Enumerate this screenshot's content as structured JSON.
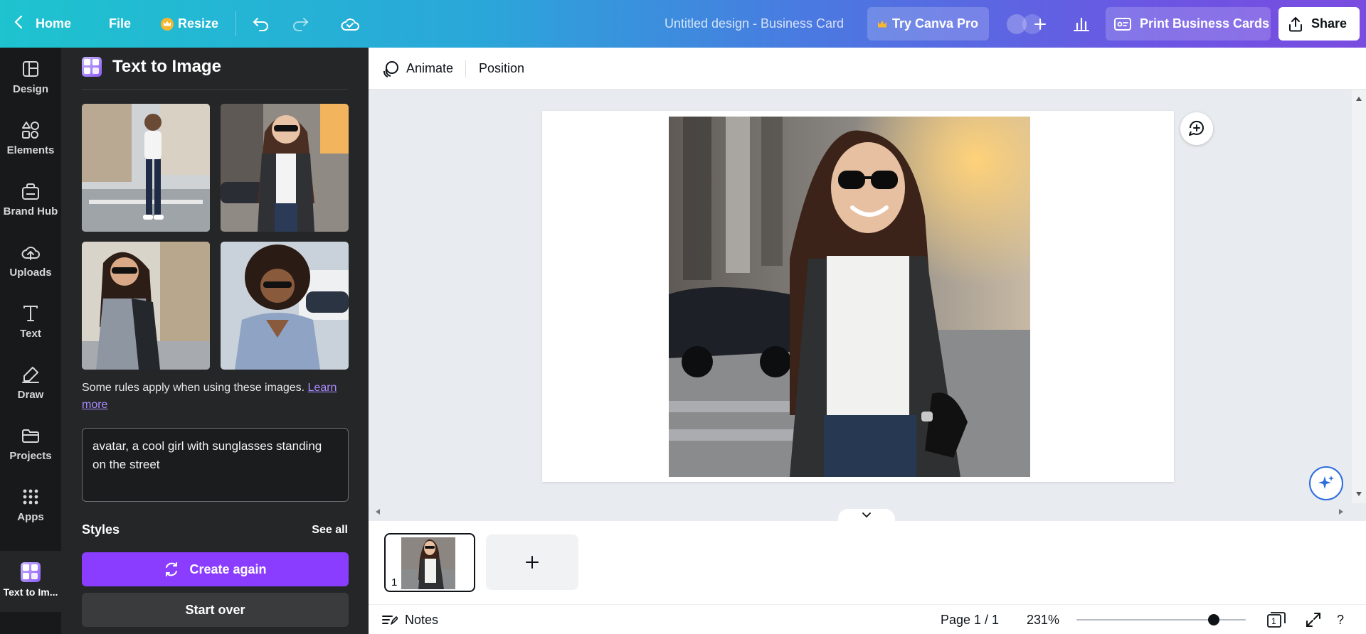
{
  "topbar": {
    "home": "Home",
    "file": "File",
    "resize": "Resize",
    "design_title": "Untitled design - Business Card",
    "try_pro": "Try Canva Pro",
    "print": "Print Business Cards",
    "share": "Share"
  },
  "rail": {
    "items": [
      {
        "label": "Design",
        "icon": "layout-icon"
      },
      {
        "label": "Elements",
        "icon": "shapes-icon"
      },
      {
        "label": "Brand Hub",
        "icon": "brand-icon"
      },
      {
        "label": "Uploads",
        "icon": "cloud-upload-icon"
      },
      {
        "label": "Text",
        "icon": "text-icon"
      },
      {
        "label": "Draw",
        "icon": "pen-icon"
      },
      {
        "label": "Projects",
        "icon": "folder-icon"
      },
      {
        "label": "Apps",
        "icon": "grid-icon"
      },
      {
        "label": "Text to Im...",
        "icon": "text-to-image-icon"
      }
    ]
  },
  "panel": {
    "title": "Text to Image",
    "rules_text": "Some rules apply when using these images. ",
    "learn_more": "Learn more",
    "prompt": "avatar, a cool girl with sunglasses standing on the street",
    "styles_title": "Styles",
    "see_all": "See all",
    "create_again": "Create again",
    "start_over": "Start over"
  },
  "context_bar": {
    "animate": "Animate",
    "position": "Position"
  },
  "pages": {
    "thumb_number": "1"
  },
  "status": {
    "notes": "Notes",
    "page_indicator": "Page 1 / 1",
    "zoom": "231%",
    "page_count": "1",
    "help": "?"
  },
  "colors": {
    "accent": "#8b3dff",
    "panel_bg": "#252627",
    "rail_bg": "#18191b"
  }
}
